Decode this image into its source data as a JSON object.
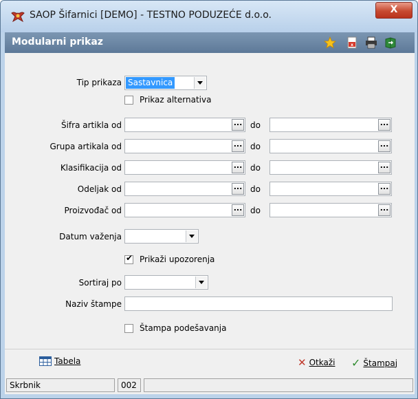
{
  "window": {
    "title": "SAOP Šifarnici [DEMO] - TESTNO PODUZEĆE d.o.o.",
    "close_label": "X"
  },
  "header": {
    "title": "Modularni prikaz",
    "icons": [
      "star-icon",
      "pdf-icon",
      "printer-icon",
      "book-exit-icon"
    ]
  },
  "form": {
    "tip_prikaza": {
      "label": "Tip prikaza",
      "value": "Sastavnica"
    },
    "prikaz_alternativa": {
      "label": "Prikaz alternativa",
      "checked": false
    },
    "ranges": [
      {
        "label": "Šifra artikla od",
        "from": "",
        "to_label": "do",
        "to": ""
      },
      {
        "label": "Grupa artikala od",
        "from": "",
        "to_label": "do",
        "to": ""
      },
      {
        "label": "Klasifikacija od",
        "from": "",
        "to_label": "do",
        "to": ""
      },
      {
        "label": "Odeljak od",
        "from": "",
        "to_label": "do",
        "to": ""
      },
      {
        "label": "Proizvođač od",
        "from": "",
        "to_label": "do",
        "to": ""
      }
    ],
    "ellipsis": "...",
    "datum_vazenja": {
      "label": "Datum važenja",
      "value": ""
    },
    "prikazi_upozorenja": {
      "label": "Prikaži upozorenja",
      "checked": true,
      "mark": "✔"
    },
    "sortiraj_po": {
      "label": "Sortiraj po",
      "value": ""
    },
    "naziv_stampe": {
      "label": "Naziv štampe",
      "value": ""
    },
    "stampa_podesavanja": {
      "label": "Štampa podešavanja",
      "checked": false
    }
  },
  "footer": {
    "tabela": "Tabela",
    "otkazi": "Otkaži",
    "stampaj": "Štampaj",
    "cancel_mark": "✕",
    "ok_mark": "✓",
    "colors": {
      "cancel": "#c0392b",
      "ok": "#2e8b2e"
    }
  },
  "status": {
    "user": "Skrbnik",
    "code": "002"
  }
}
